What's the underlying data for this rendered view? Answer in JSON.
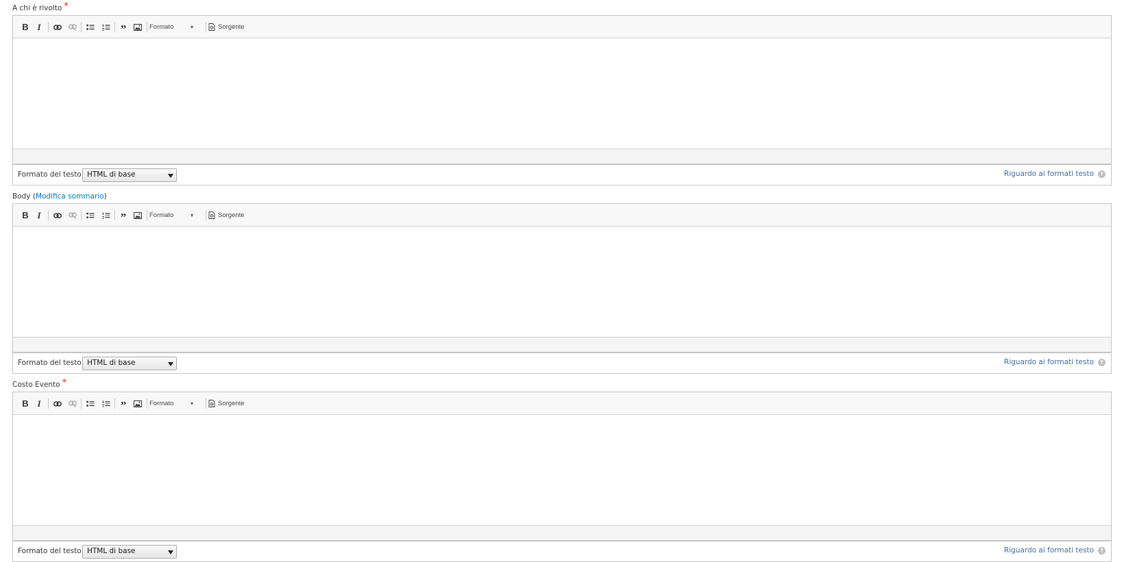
{
  "toolbar": {
    "bold_label": "B",
    "italic_label": "I",
    "quote_label": "”",
    "format_label": "Formato",
    "format_caret": "▾",
    "source_label": "Sorgente"
  },
  "format_bar": {
    "label": "Formato del testo",
    "selected": "HTML di base",
    "about_link": "Riguardo ai formati testo",
    "help_icon": "?"
  },
  "fields": [
    {
      "label": "A chi è rivolto",
      "required_mark": "*"
    },
    {
      "label": "Body (",
      "link": "Modifica sommario",
      "label_suffix": ")"
    },
    {
      "label": "Costo Evento",
      "required_mark": "*"
    }
  ],
  "colors": {
    "required": "#e62600",
    "link": "#0074bd",
    "about_link": "#3e6ba3",
    "toolbar_bg": "#f8f8f8",
    "border": "#c4c4c4"
  }
}
